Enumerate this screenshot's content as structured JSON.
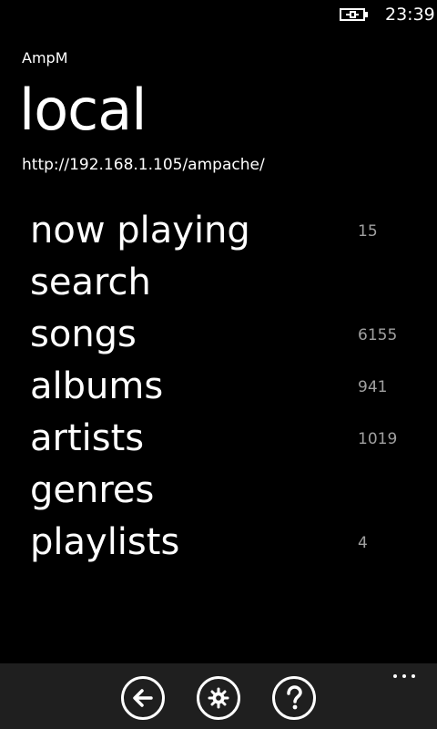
{
  "status_bar": {
    "time": "23:39",
    "battery_icon": "battery-charging-icon"
  },
  "header": {
    "app_title": "AmpM",
    "page_title": "local",
    "server_url": "http://192.168.1.105/ampache/"
  },
  "menu": {
    "items": [
      {
        "label": "now playing",
        "count": "15"
      },
      {
        "label": "search",
        "count": ""
      },
      {
        "label": "songs",
        "count": "6155"
      },
      {
        "label": "albums",
        "count": "941"
      },
      {
        "label": "artists",
        "count": "1019"
      },
      {
        "label": "genres",
        "count": ""
      },
      {
        "label": "playlists",
        "count": "4"
      }
    ]
  },
  "app_bar": {
    "background": "#1f1f1f",
    "buttons": [
      {
        "icon": "back-icon"
      },
      {
        "icon": "settings-icon"
      },
      {
        "icon": "help-icon"
      }
    ],
    "more_icon": "more-icon"
  }
}
